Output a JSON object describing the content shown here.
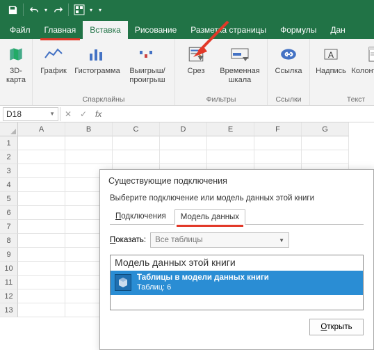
{
  "titlebar": {
    "save_icon": "save",
    "undo_icon": "undo",
    "redo_icon": "redo",
    "customize_icon": "table-wizard"
  },
  "tabs": {
    "file": "Файл",
    "home": "Главная",
    "insert": "Вставка",
    "drawing": "Рисование",
    "pagelayout": "Разметка страницы",
    "formulas": "Формулы",
    "data": "Дан"
  },
  "ribbon": {
    "g1_items": [
      "3D-\nкарта"
    ],
    "g2_items": [
      "График",
      "Гистограмма",
      "Выигрыш/\nпроигрыш"
    ],
    "g2_title": "Спарклайны",
    "g3_items": [
      "Срез",
      "Временная\nшкала"
    ],
    "g3_title": "Фильтры",
    "g4_items": [
      "Ссылка"
    ],
    "g4_title": "Ссылки",
    "g5_items": [
      "Надпись",
      "Колонтитулы"
    ],
    "g5_title": "Текст"
  },
  "namebox": {
    "value": "D18"
  },
  "formula": {
    "fx": "fx",
    "value": ""
  },
  "cols": [
    "A",
    "B",
    "C",
    "D",
    "E",
    "F",
    "G"
  ],
  "rows": [
    "1",
    "2",
    "3",
    "4",
    "5",
    "6",
    "7",
    "8",
    "9",
    "10",
    "11",
    "12",
    "13"
  ],
  "dialog": {
    "title": "Существующие подключения",
    "msg": "Выберите подключение или модель данных этой книги",
    "tab1": "Подключения",
    "tab1_ul": "П",
    "tab2": "Модель данных",
    "show_label": "оказать:",
    "show_label_ul": "П",
    "show_value": "Все таблицы",
    "section": "Модель данных этой книги",
    "item_t1": "Таблицы в модели данных книги",
    "item_t2": "Таблиц: 6",
    "open": "ткрыть",
    "open_ul": "О"
  }
}
